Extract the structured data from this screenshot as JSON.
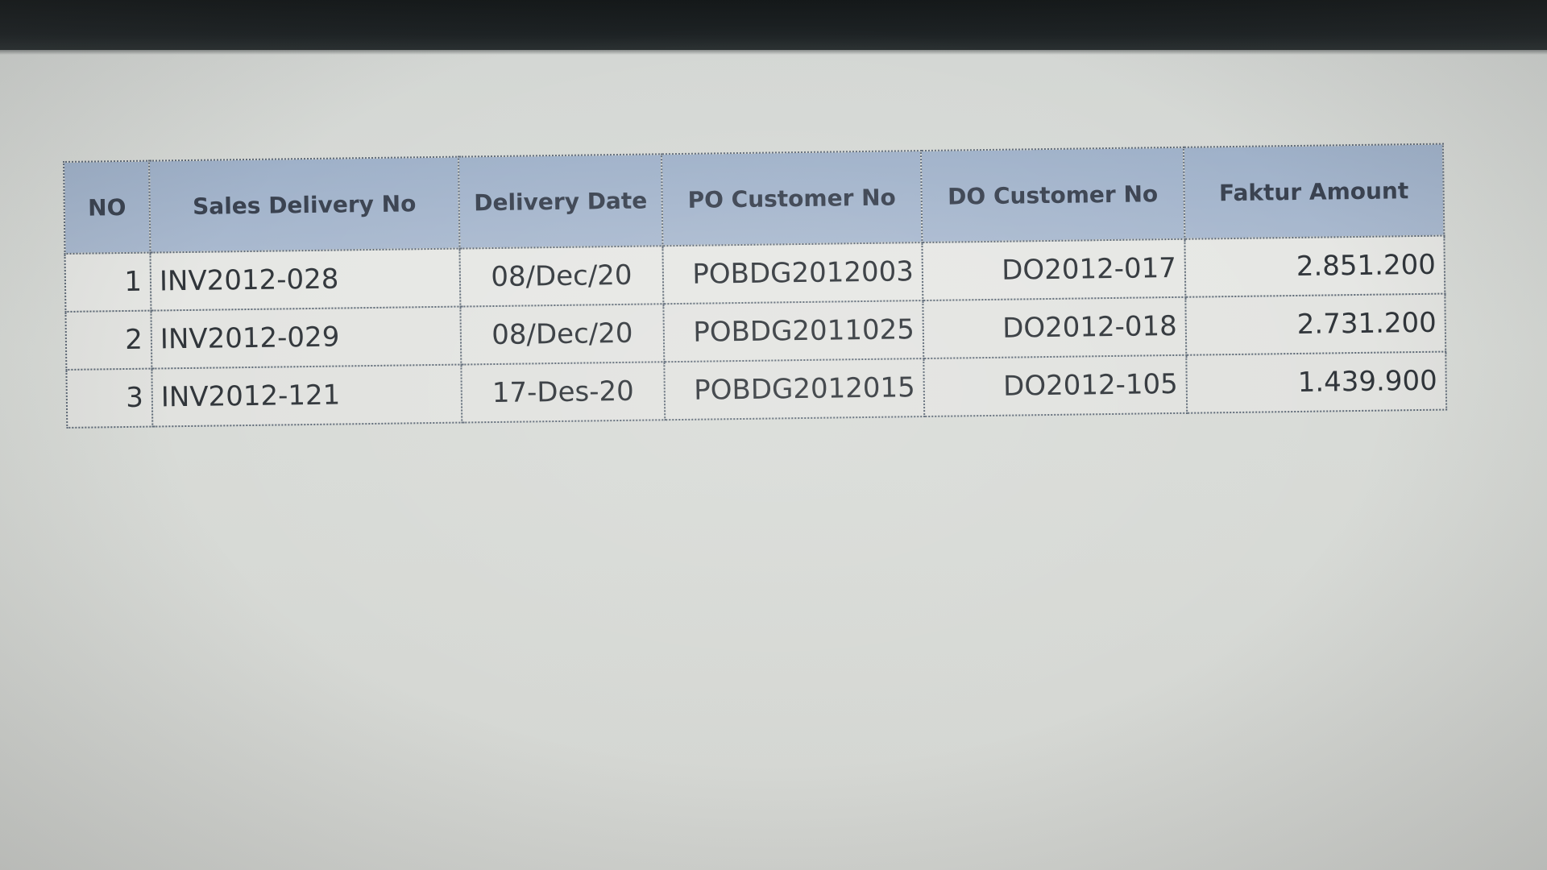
{
  "table": {
    "headers": [
      "NO",
      "Sales Delivery No",
      "Delivery Date",
      "PO Customer No",
      "DO Customer No",
      "Faktur Amount"
    ],
    "rows": [
      {
        "no": "1",
        "sales_delivery_no": "INV2012-028",
        "delivery_date": "08/Dec/20",
        "po_customer_no": "POBDG2012003",
        "do_customer_no": "DO2012-017",
        "faktur_amount": "2.851.200"
      },
      {
        "no": "2",
        "sales_delivery_no": "INV2012-029",
        "delivery_date": "08/Dec/20",
        "po_customer_no": "POBDG2011025",
        "do_customer_no": "DO2012-018",
        "faktur_amount": "2.731.200"
      },
      {
        "no": "3",
        "sales_delivery_no": "INV2012-121",
        "delivery_date": "17-Des-20",
        "po_customer_no": "POBDG2012015",
        "do_customer_no": "DO2012-105",
        "faktur_amount": "1.439.900"
      }
    ]
  },
  "colors": {
    "header_background": "#a4b5cc",
    "cell_background": "#e5e6e3",
    "border": "#5f6a78",
    "text": "#30353a"
  }
}
